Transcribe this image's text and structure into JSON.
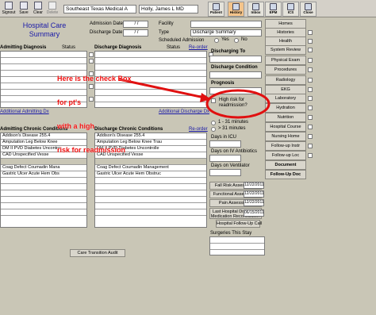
{
  "toolbar": {
    "buttons": [
      {
        "label": "Signout",
        "icon": "signout-icon"
      },
      {
        "label": "Save",
        "icon": "save-icon"
      },
      {
        "label": "Clear",
        "icon": "clear-icon"
      },
      {
        "label": "Delete",
        "icon": "delete-icon"
      }
    ],
    "facility_select": "Southeast Texas Medical A",
    "patient_select": "Holly, James  L MD",
    "tiles": [
      {
        "label": "Patient",
        "active": false
      },
      {
        "label": "History",
        "active": true
      },
      {
        "label": "Inbox",
        "active": false
      },
      {
        "label": "EPM",
        "active": false
      },
      {
        "label": "ICS",
        "active": false
      },
      {
        "label": "Close",
        "active": false
      }
    ]
  },
  "form": {
    "title_line1": "Hospital Care",
    "title_line2": "Summary",
    "admission_date_label": "Admission Date",
    "admission_date_value": "/ /",
    "discharge_date_label": "Discharge Date",
    "discharge_date_value": "/ /",
    "facility_label": "Facility",
    "type_label": "Type",
    "type_value": "Discharge Summary",
    "scheduled_admission_label": "Scheduled Admission",
    "yes_label": "Yes",
    "no_label": "No",
    "admitting_diagnosis_header": "Admitting Diagnosis",
    "status_header": "Status",
    "discharge_diagnosis_header": "Discharge Diagnosis",
    "status_header2": "Status",
    "reorder_label": "Re-order",
    "additional_admitting_label": "Additional Admitting Dx",
    "additional_discharge_label": "Additional Discharge Dx",
    "admitting_chronic_header": "Admitting Chronic Conditions",
    "discharge_chronic_header": "Discharge Chronic Conditions",
    "reorder_label2": "Re-order",
    "admitting_chronic_rows": [
      "Addison's Disease  255.4",
      "Amputation Leg Below Knee",
      "DM II PVD Diabetes Uncontro",
      "CAD Unspecified Vesse",
      "",
      "Coag Defect Coumadin Mana",
      "Gastric Ulcer Acute Hem Obs"
    ],
    "discharge_chronic_rows": [
      "Addison's Disease  255.4",
      "Amputation Leg Below Knee Trau",
      "DM II PVD Diabetes Uncontrolle",
      "CAD Unspecified Vesse",
      "",
      "Coag Defect Coumadin Management",
      "Gastric Ulcer Acute Hem Obstruc"
    ],
    "care_transition_audit_label": "Care Transition Audit"
  },
  "right_panel": {
    "discharging_to_label": "Discharging To",
    "discharge_condition_label": "Discharge Condition",
    "prognosis_label": "Prognosis",
    "high_risk_label_line1": "High risk for",
    "high_risk_label_line2": "readmission?",
    "los_opt1": "1 - 31 minutes",
    "los_opt2": "> 31 minutes",
    "days_icu_label": "Days in ICU",
    "days_iv_label": "Days on IV Antibiotics",
    "days_vent_label": "Days on Ventilator",
    "fall_risk_label": "Fall Risk Assessment",
    "fall_risk_date": "12/22/2011",
    "functional_label": "Functional Assessment",
    "functional_date": "12/22/2011",
    "pain_label": "Pain Assessment",
    "pain_date": "12/22/2011",
    "med_rec_line1": "Last Hospital Discharge",
    "med_rec_line2": "Medication Reconciliation",
    "med_rec_date": "06/15/2011",
    "follow_up_call_label": "Hospital Follow-Up Call",
    "surgeries_label": "Surgeries This Stay"
  },
  "nav": {
    "items": [
      {
        "label": "Homes",
        "bold": false
      },
      {
        "label": "Histories",
        "bold": false
      },
      {
        "label": "Health",
        "bold": false
      },
      {
        "label": "System Review",
        "bold": false
      },
      {
        "label": "Physical Exam",
        "bold": false
      },
      {
        "label": "Procedures",
        "bold": false
      },
      {
        "label": "Radiology",
        "bold": false
      },
      {
        "label": "EKG",
        "bold": false
      },
      {
        "label": "Laboratory",
        "bold": false
      },
      {
        "label": "Hydration",
        "bold": false
      },
      {
        "label": "Nutrition",
        "bold": false
      },
      {
        "label": "Hospital Course",
        "bold": false
      },
      {
        "label": "Nursing Home",
        "bold": false
      },
      {
        "label": "Follow-up Instr",
        "bold": false
      },
      {
        "label": "Follow-up Loc",
        "bold": false
      },
      {
        "label": "Document",
        "bold": true
      },
      {
        "label": "Follow-Up Doc",
        "bold": true
      }
    ]
  },
  "annotation": {
    "text_line1": "Here is the check Box",
    "text_line2": "for pt's",
    "text_line3": "with a high",
    "text_line4": "risk for readmission",
    "color": "#f01010"
  }
}
